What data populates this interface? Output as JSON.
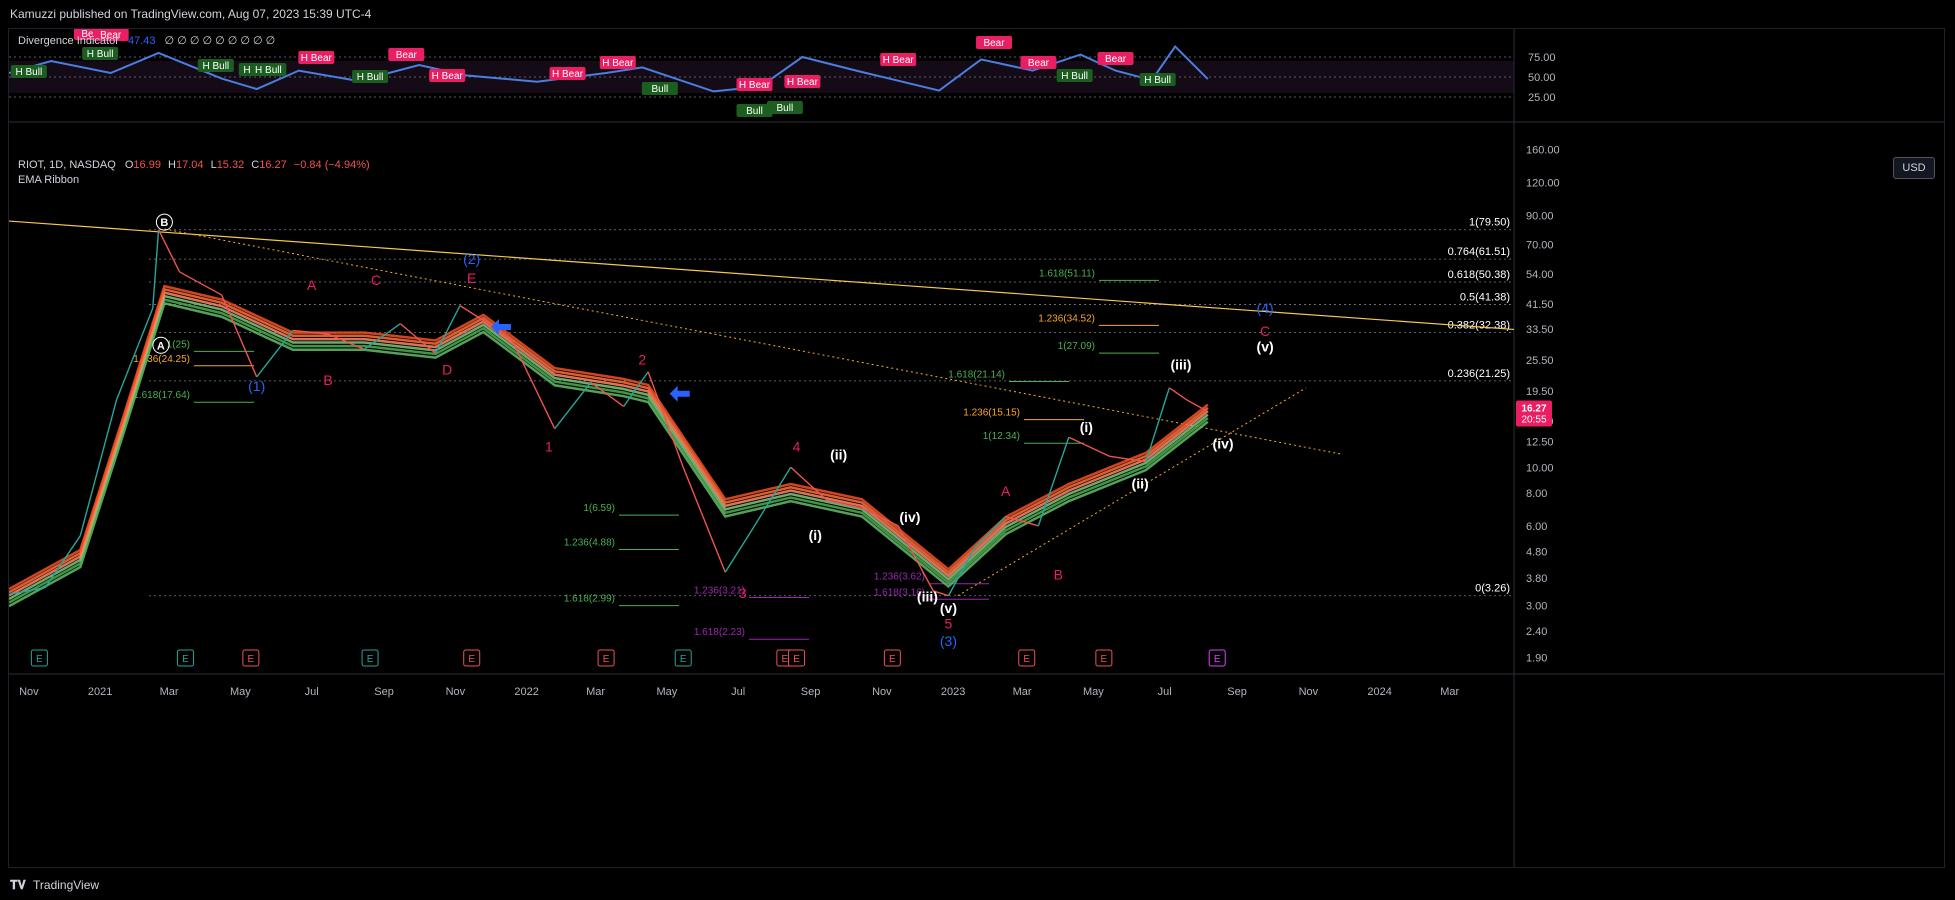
{
  "header": {
    "published": "Kamuzzi published on TradingView.com, Aug 07, 2023 15:39 UTC-4"
  },
  "footer": {
    "brand": "TradingView"
  },
  "indicator": {
    "name": "Divergence Indicator",
    "value": "47.43",
    "placeholders": "∅ ∅ ∅ ∅ ∅ ∅ ∅ ∅ ∅",
    "levels": [
      "75.00",
      "50.00",
      "25.00"
    ],
    "bull_labels": [
      "H Bull",
      "H Bull",
      "H Bull",
      "H Bull",
      "H Bull",
      "H Bull",
      "Bull",
      "Bull",
      "Bull",
      "H Bull",
      "H Bull"
    ],
    "bear_labels": [
      "Bear",
      "Bear",
      "H Bear",
      "Bear",
      "H Bear",
      "H Bear",
      "H Bear",
      "H Bear",
      "H Bear",
      "H Bear",
      "Bear",
      "Bear",
      "Bear"
    ]
  },
  "main_legend": {
    "symbol": "RIOT, 1D, NASDAQ",
    "o_label": "O",
    "o": "16.99",
    "h_label": "H",
    "h": "17.04",
    "l_label": "L",
    "l": "15.32",
    "c_label": "C",
    "c": "16.27",
    "change": "−0.84 (−4.94%)",
    "study": "EMA Ribbon"
  },
  "currency": "USD",
  "last_price": {
    "price": "16.27",
    "countdown": "20:55"
  },
  "colors": {
    "up": "#26a69a",
    "down": "#ef5350",
    "ribbon_green": "#4caf50",
    "ribbon_red": "#ff7043",
    "accent_red": "#e91e63",
    "blue": "#2962ff",
    "fib_yellow": "#f9a825"
  },
  "chart_data": {
    "type": "line",
    "title": "",
    "xlabel": "",
    "ylabel": "",
    "y_scale": "log",
    "y_ticks": [
      "160.00",
      "120.00",
      "90.00",
      "70.00",
      "54.00",
      "41.50",
      "33.50",
      "25.50",
      "19.50",
      "15.00",
      "12.50",
      "10.00",
      "8.00",
      "6.00",
      "4.80",
      "3.80",
      "3.00",
      "2.40",
      "1.90"
    ],
    "x_ticks": [
      "Nov",
      "2021",
      "Mar",
      "May",
      "Jul",
      "Sep",
      "Nov",
      "2022",
      "Mar",
      "May",
      "Jul",
      "Sep",
      "Nov",
      "2023",
      "Mar",
      "May",
      "Jul",
      "Sep",
      "Nov",
      "2024",
      "Mar"
    ],
    "price_path": {
      "x": [
        "2020-10-15",
        "2020-11-15",
        "2020-12-15",
        "2021-01-15",
        "2021-02-15",
        "2021-02-20",
        "2021-03-10",
        "2021-04-15",
        "2021-05-15",
        "2021-06-15",
        "2021-07-15",
        "2021-08-15",
        "2021-09-15",
        "2021-10-15",
        "2021-11-05",
        "2021-11-25",
        "2021-12-20",
        "2022-01-25",
        "2022-02-25",
        "2022-03-25",
        "2022-04-15",
        "2022-05-15",
        "2022-06-20",
        "2022-07-15",
        "2022-08-15",
        "2022-09-15",
        "2022-10-15",
        "2022-11-15",
        "2022-12-15",
        "2022-12-28",
        "2023-01-20",
        "2023-02-15",
        "2023-03-15",
        "2023-04-10",
        "2023-05-15",
        "2023-06-15",
        "2023-07-05",
        "2023-07-20",
        "2023-08-07"
      ],
      "y": [
        3.3,
        3.5,
        5.5,
        18,
        40,
        79.5,
        55,
        45,
        22,
        33,
        32,
        28,
        35,
        27,
        41,
        36,
        30,
        14,
        21,
        17,
        23,
        10,
        4.0,
        6,
        10,
        7.5,
        7,
        6,
        3.4,
        3.26,
        5,
        6.5,
        6,
        13,
        11,
        10.5,
        20,
        18,
        16.27
      ]
    },
    "ema_ribbon": {
      "x": [
        "2020-10-15",
        "2020-12-15",
        "2021-01-20",
        "2021-02-25",
        "2021-04-15",
        "2021-06-15",
        "2021-08-15",
        "2021-10-15",
        "2021-11-25",
        "2022-01-25",
        "2022-03-25",
        "2022-04-15",
        "2022-06-20",
        "2022-08-15",
        "2022-10-15",
        "2022-12-28",
        "2023-02-15",
        "2023-04-10",
        "2023-06-15",
        "2023-08-07"
      ],
      "y": [
        3.2,
        4.5,
        14,
        45,
        40,
        30,
        30,
        28,
        35,
        22,
        20,
        19,
        7,
        8,
        7,
        3.8,
        6,
        8,
        10.5,
        16
      ]
    },
    "oscillator": {
      "x": [
        "2020-10-15",
        "2020-11-20",
        "2021-01-10",
        "2021-02-20",
        "2021-04-15",
        "2021-05-15",
        "2021-06-20",
        "2021-08-10",
        "2021-10-01",
        "2021-11-10",
        "2022-01-10",
        "2022-03-10",
        "2022-04-10",
        "2022-06-10",
        "2022-07-20",
        "2022-08-25",
        "2022-10-10",
        "2022-12-20",
        "2023-01-25",
        "2023-03-10",
        "2023-04-20",
        "2023-05-20",
        "2023-06-20",
        "2023-07-10",
        "2023-08-07"
      ],
      "y": [
        55,
        70,
        55,
        80,
        48,
        35,
        58,
        45,
        65,
        52,
        44,
        55,
        62,
        32,
        38,
        75,
        58,
        33,
        72,
        58,
        78,
        58,
        46,
        88,
        47.43
      ]
    },
    "horizontal_levels": [
      {
        "label": "1(79.50)",
        "value": 79.5
      },
      {
        "label": "0.764(61.51)",
        "value": 61.51
      },
      {
        "label": "0.618(50.38)",
        "value": 50.38
      },
      {
        "label": "0.5(41.38)",
        "value": 41.38
      },
      {
        "label": "0.382(32.38)",
        "value": 32.38
      },
      {
        "label": "0.236(21.25)",
        "value": 21.25
      },
      {
        "label": "0(3.26)",
        "value": 3.26
      }
    ],
    "fib_annotations": [
      {
        "label": "1.618(51.11)",
        "value": 51.11,
        "color": "#4caf50"
      },
      {
        "label": "1.236(34.52)",
        "value": 34.52,
        "color": "#f9a825"
      },
      {
        "label": "1(27.09)",
        "value": 27.09,
        "color": "#4caf50"
      },
      {
        "label": "1.618(21.14)",
        "value": 21.14,
        "color": "#4caf50"
      },
      {
        "label": "1.236(15.15)",
        "value": 15.15,
        "color": "#f9a825"
      },
      {
        "label": "1(12.34)",
        "value": 12.34,
        "color": "#4caf50"
      },
      {
        "label": "1(6.59)",
        "value": 6.59,
        "color": "#4caf50"
      },
      {
        "label": "1.236(4.88)",
        "value": 4.88,
        "color": "#4caf50"
      },
      {
        "label": "1.618(2.99)",
        "value": 2.99,
        "color": "#4caf50"
      },
      {
        "label": "1.236(3.21)",
        "value": 3.21,
        "color": "#9c27b0"
      },
      {
        "label": "1.618(2.23)",
        "value": 2.23,
        "color": "#9c27b0"
      },
      {
        "label": "1.236(3.62)",
        "value": 3.62,
        "color": "#9c27b0"
      },
      {
        "label": "1.618(3.16)",
        "value": 3.16,
        "color": "#9c27b0"
      },
      {
        "label": "1(25)",
        "value": 27.5,
        "color": "#4caf50"
      },
      {
        "label": "1.236(24.25)",
        "value": 24.25,
        "color": "#f9a825"
      },
      {
        "label": "1.618(17.64)",
        "value": 17.64,
        "color": "#4caf50"
      }
    ],
    "wave_labels": [
      {
        "label": "B",
        "x": "2021-02-25",
        "y": 82,
        "color": "#ffffff",
        "circled": true
      },
      {
        "label": "A",
        "x": "2021-02-22",
        "y": 28,
        "color": "#ffffff",
        "circled": true
      },
      {
        "label": "(1)",
        "x": "2021-05-15",
        "y": 19.5,
        "color": "#2962ff"
      },
      {
        "label": "A",
        "x": "2021-07-01",
        "y": 47,
        "color": "#e91e63"
      },
      {
        "label": "B",
        "x": "2021-07-15",
        "y": 20.5,
        "color": "#e91e63"
      },
      {
        "label": "C",
        "x": "2021-08-25",
        "y": 49,
        "color": "#e91e63"
      },
      {
        "label": "D",
        "x": "2021-10-25",
        "y": 22.5,
        "color": "#e91e63"
      },
      {
        "label": "E",
        "x": "2021-11-15",
        "y": 50,
        "color": "#e91e63"
      },
      {
        "label": "(2)",
        "x": "2021-11-15",
        "y": 59,
        "color": "#2962ff"
      },
      {
        "label": "1",
        "x": "2022-01-20",
        "y": 11.5,
        "color": "#e91e63"
      },
      {
        "label": "2",
        "x": "2022-04-10",
        "y": 24.5,
        "color": "#e91e63"
      },
      {
        "label": "3",
        "x": "2022-07-05",
        "y": 3.2,
        "color": "#e91e63"
      },
      {
        "label": "4",
        "x": "2022-08-20",
        "y": 11.5,
        "color": "#e91e63"
      },
      {
        "label": "(ii)",
        "x": "2022-09-25",
        "y": 10.7,
        "color": "#ffffff"
      },
      {
        "label": "(i)",
        "x": "2022-09-05",
        "y": 5.3,
        "color": "#ffffff"
      },
      {
        "label": "(iv)",
        "x": "2022-11-25",
        "y": 6.2,
        "color": "#ffffff"
      },
      {
        "label": "(iii)",
        "x": "2022-12-10",
        "y": 3.1,
        "color": "#ffffff"
      },
      {
        "label": "(v)",
        "x": "2022-12-28",
        "y": 2.8,
        "color": "#ffffff"
      },
      {
        "label": "5",
        "x": "2022-12-28",
        "y": 2.45,
        "color": "#e91e63"
      },
      {
        "label": "(3)",
        "x": "2022-12-28",
        "y": 2.1,
        "color": "#2962ff"
      },
      {
        "label": "A",
        "x": "2023-02-15",
        "y": 7.8,
        "color": "#e91e63"
      },
      {
        "label": "B",
        "x": "2023-04-01",
        "y": 3.75,
        "color": "#e91e63"
      },
      {
        "label": "(i)",
        "x": "2023-04-25",
        "y": 13.6,
        "color": "#ffffff"
      },
      {
        "label": "(ii)",
        "x": "2023-06-10",
        "y": 8.3,
        "color": "#ffffff"
      },
      {
        "label": "(iii)",
        "x": "2023-07-15",
        "y": 23.5,
        "color": "#ffffff"
      },
      {
        "label": "(iv)",
        "x": "2023-08-20",
        "y": 11.8,
        "color": "#ffffff"
      },
      {
        "label": "(v)",
        "x": "2023-09-25",
        "y": 27.5,
        "color": "#ffffff"
      },
      {
        "label": "C",
        "x": "2023-09-25",
        "y": 31.5,
        "color": "#e91e63"
      },
      {
        "label": "(4)",
        "x": "2023-09-25",
        "y": 38.5,
        "color": "#2962ff"
      }
    ],
    "trendlines": [
      {
        "name": "upper",
        "color": "#f9c74f",
        "x": [
          "2020-09-25",
          "2024-04-25"
        ],
        "y": [
          87,
          33.3
        ],
        "style": "solid"
      },
      {
        "name": "dotted-down",
        "color": "#f9a825",
        "x": [
          "2021-02-25",
          "2023-11-30"
        ],
        "y": [
          80,
          11.2
        ],
        "style": "dotted"
      },
      {
        "name": "dotted-up",
        "color": "#f9a825",
        "x": [
          "2023-01-05",
          "2023-10-30"
        ],
        "y": [
          3.26,
          20
        ],
        "style": "dotted"
      }
    ],
    "arrows": [
      {
        "x": "2021-12-10",
        "y": 34,
        "dir": "left",
        "color": "#2962ff"
      },
      {
        "x": "2022-05-12",
        "y": 19,
        "dir": "left",
        "color": "#2962ff"
      }
    ],
    "earnings_markers": [
      {
        "x": "2020-11-10",
        "label": "E",
        "type": "positive"
      },
      {
        "x": "2021-03-15",
        "label": "E",
        "type": "positive"
      },
      {
        "x": "2021-05-10",
        "label": "E",
        "type": "negative"
      },
      {
        "x": "2021-08-20",
        "label": "E",
        "type": "positive"
      },
      {
        "x": "2021-11-15",
        "label": "E",
        "type": "negative"
      },
      {
        "x": "2022-03-10",
        "label": "E",
        "type": "negative"
      },
      {
        "x": "2022-05-15",
        "label": "E",
        "type": "positive"
      },
      {
        "x": "2022-08-10",
        "label": "E",
        "type": "negative"
      },
      {
        "x": "2022-08-20",
        "label": "E",
        "type": "negative"
      },
      {
        "x": "2022-11-10",
        "label": "E",
        "type": "negative"
      },
      {
        "x": "2023-03-05",
        "label": "E",
        "type": "negative"
      },
      {
        "x": "2023-05-10",
        "label": "E",
        "type": "negative"
      },
      {
        "x": "2023-08-15",
        "label": "E",
        "type": "future"
      }
    ]
  }
}
